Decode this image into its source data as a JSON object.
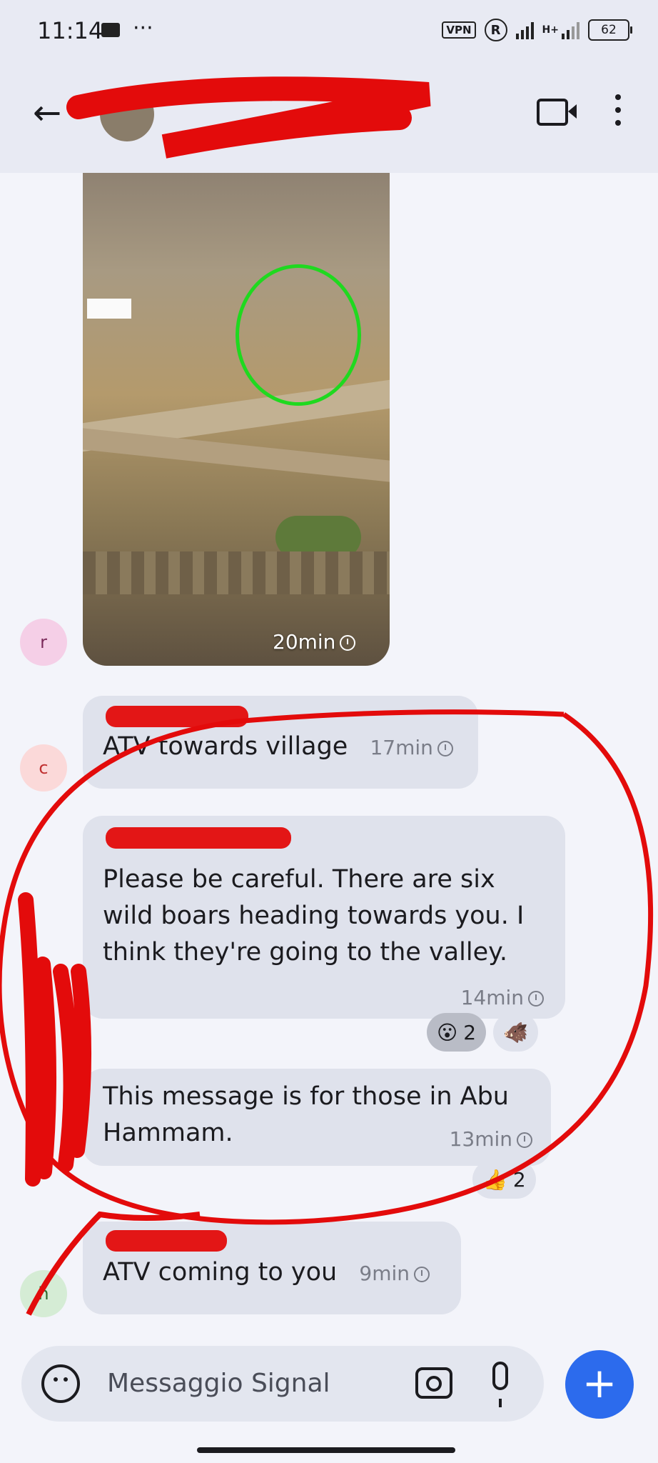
{
  "status_bar": {
    "time": "11:14",
    "dots": "···",
    "vpn": "VPN",
    "r_badge": "R",
    "net": "H+",
    "battery": "62"
  },
  "header": {
    "title": "",
    "back_icon": "arrow-left-icon",
    "video_icon": "video-call-icon",
    "menu_icon": "more-vertical-icon"
  },
  "messages": [
    {
      "type": "image",
      "avatar": "r",
      "time": "20min"
    },
    {
      "type": "text",
      "avatar": "c",
      "text": "ATV towards village",
      "time": "17min"
    },
    {
      "type": "text",
      "text": "Please be careful. There are six wild boars heading towards you. I think they're going to the valley.",
      "time": "14min",
      "reactions": [
        {
          "emoji": "😮",
          "count": "2"
        },
        {
          "emoji": "🐗",
          "count": ""
        }
      ]
    },
    {
      "type": "text",
      "text": "This message is for those in Abu Hammam.",
      "time": "13min",
      "reactions": [
        {
          "emoji": "👍",
          "count": "2"
        }
      ]
    },
    {
      "type": "text",
      "avatar": "h",
      "text": "ATV coming to you",
      "time": "9min"
    }
  ],
  "composer": {
    "placeholder": "Messaggio Signal"
  },
  "colors": {
    "accent": "#2c6bed",
    "bubble": "#dfe2ec",
    "annotation_red": "#e30b0b",
    "circle_green": "#1fd91f"
  }
}
